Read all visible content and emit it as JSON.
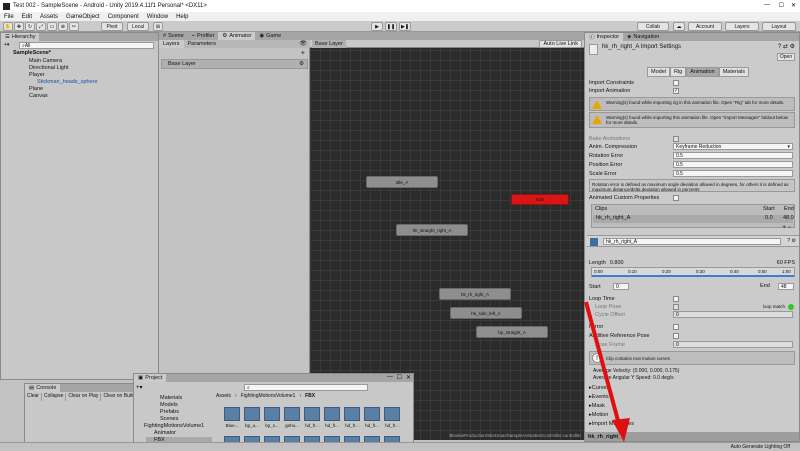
{
  "window": {
    "title": "Test 002 - SampleScene - Android - Unity 2019.4.11f1 Personal* <DX11>"
  },
  "menu": [
    "File",
    "Edit",
    "Assets",
    "GameObject",
    "Component",
    "Window",
    "Help"
  ],
  "toolbar": {
    "pivot": "Pivot",
    "local": "Local",
    "collab": "Collab",
    "account": "Account",
    "layers": "Layers",
    "layout": "Layout"
  },
  "hierarchy": {
    "tab": "Hierarchy",
    "search_placeholder": "All",
    "items": [
      "SampleScene*",
      "Main Camera",
      "Directional Light",
      "Player",
      "Stickman_heads_sphere",
      "Plane",
      "Canvas"
    ]
  },
  "center_tabs": {
    "scene": "Scene",
    "profiler": "Profiler",
    "animator": "Animator",
    "game": "Game"
  },
  "animator": {
    "layers_tab": "Layers",
    "parameters_tab": "Parameters",
    "base_layer": "Base Layer",
    "breadcrumb": "Base Layer",
    "auto_live_link": "Auto Live Link",
    "nodes": [
      "Idle_A",
      "Exit",
      "hk_straight_right_A",
      "hk_rh_right_A",
      "hk_side_left_A",
      "hp_straight_A"
    ],
    "path": "BloukieProduction/Stickman/SampleAnimationController.controller"
  },
  "console": {
    "tab": "Console",
    "clear": "Clear",
    "collapse": "Collapse",
    "clear_on_play": "Clear on Play",
    "clear_on_build": "Clear on Build"
  },
  "project": {
    "tab": "Project",
    "folders": [
      "Materials",
      "Models",
      "Prefabs",
      "Scenes",
      "FightingMotionsVolume1",
      "Animator",
      "FBX",
      "nomove"
    ],
    "breadcrumb": [
      "Assets",
      "FightingMotionsVolume1",
      "FBX"
    ],
    "thumbs": [
      "Blue...",
      "bp_u...",
      "bp_s...",
      "gehu...",
      "hd_fr...",
      "hd_fr...",
      "hd_fr...",
      "hd_fr...",
      "hd_fr...",
      "hk_st..."
    ]
  },
  "inspector": {
    "tab": "Inspector",
    "nav_tab": "Navigation",
    "title": "hk_rh_right_A Import Settings",
    "open": "Open",
    "tabs": [
      "Model",
      "Rig",
      "Animation",
      "Materials"
    ],
    "import_constraints": "Import Constraints",
    "import_animation": "Import Animation",
    "warning1": "Warning(s) found while importing rig in this animation file. Open \"Rig\" tab for more details.",
    "warning2": "Warning(s) found while importing this animation file. Open \"Import Messages\" foldout below for more details.",
    "bake_animations": "Bake Animations",
    "anim_compression": "Anim. Compression",
    "anim_compression_value": "Keyframe Reduction",
    "rotation_error": "Rotation Error",
    "rotation_error_value": "0.5",
    "position_error": "Position Error",
    "position_error_value": "0.5",
    "scale_error": "Scale Error",
    "scale_error_value": "0.5",
    "error_note": "Rotation error is defined as maximum angle deviation allowed in degrees, for others it is defined as maximum distance/delta deviation allowed in percents",
    "animated_custom_properties": "Animated Custom Properties",
    "clips": "Clips",
    "start": "Start",
    "end": "End",
    "clip_name": "hk_rh_right_A",
    "clip_start": "0.0",
    "clip_end": "48.0",
    "clip_field": "hk_rh_right_A",
    "length": "Length",
    "length_value": "0.800",
    "fps": "60 FPS",
    "ticks": [
      "0:00",
      "0:10",
      "0:20",
      "0:30",
      "0:40",
      "0:50",
      "1:00"
    ],
    "start_label": "Start",
    "start_value": "0",
    "end_label": "End",
    "end_value": "48",
    "loop_time": "Loop Time",
    "loop_pose": "Loop Pose",
    "loop_match": "loop match",
    "cycle_offset": "Cycle Offset",
    "cycle_offset_value": "0",
    "mirror": "Mirror",
    "additive": "Additive Reference Pose",
    "pose_frame": "Pose Frame",
    "pose_frame_value": "0",
    "clip_info": "Clip contains root motion curves",
    "avg_velocity": "Average Velocity: (0.000, 0.000, 0.175)",
    "avg_angular": "Average Angular Y Speed: 0.0 deg/s",
    "foldouts": [
      "Curves",
      "Events",
      "Mask",
      "Motion",
      "Import Messages"
    ],
    "preview_name": "hk_rh_right_A"
  },
  "status": {
    "right": "Auto Generate Lighting Off"
  },
  "colors": {
    "exit_node": "#d91616",
    "arrow": "#e01010"
  }
}
